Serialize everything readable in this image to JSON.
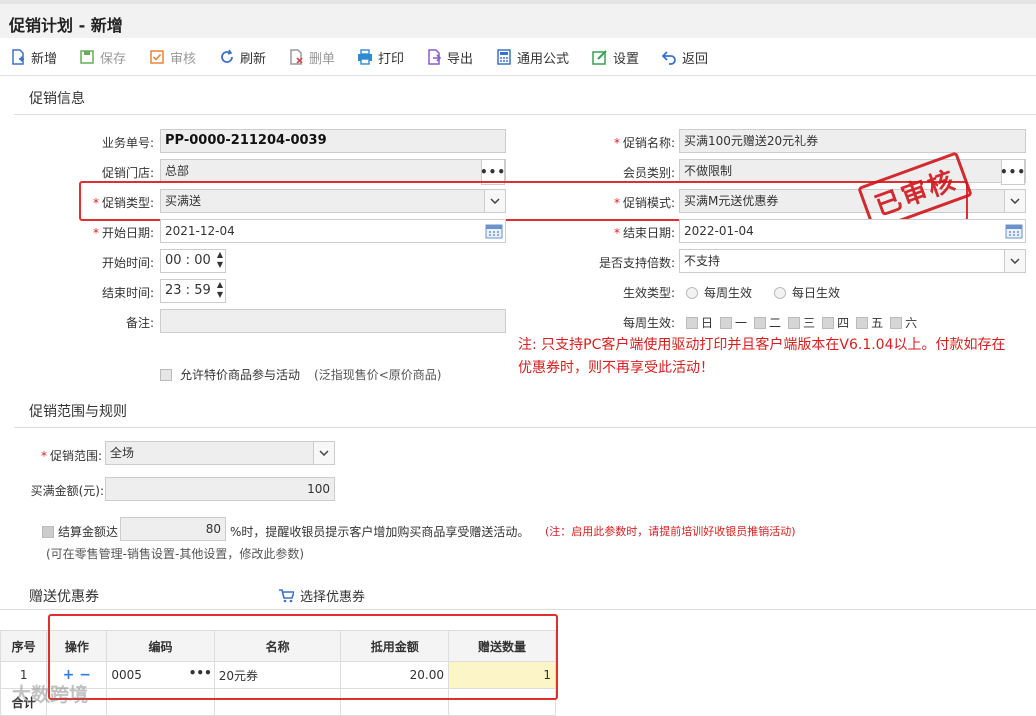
{
  "window": {
    "title": "促销计划 - 新增"
  },
  "toolbar": [
    {
      "label": "新增",
      "enabled": true,
      "icon": "new-doc-icon",
      "color": "#3a72c9"
    },
    {
      "label": "保存",
      "enabled": false,
      "icon": "save-icon",
      "color": "#6aaa5a"
    },
    {
      "label": "审核",
      "enabled": false,
      "icon": "audit-icon",
      "color": "#e6853b"
    },
    {
      "label": "刷新",
      "enabled": true,
      "icon": "refresh-icon",
      "color": "#3a72c9"
    },
    {
      "label": "删单",
      "enabled": false,
      "icon": "delete-doc-icon",
      "color": "#d94b4b"
    },
    {
      "label": "打印",
      "enabled": true,
      "icon": "print-icon",
      "color": "#2f8ad1"
    },
    {
      "label": "导出",
      "enabled": true,
      "icon": "export-icon",
      "color": "#8b5cc9"
    },
    {
      "label": "通用公式",
      "enabled": true,
      "icon": "formula-icon",
      "color": "#3a72c9"
    },
    {
      "label": "设置",
      "enabled": true,
      "icon": "settings-icon",
      "color": "#3aa054"
    },
    {
      "label": "返回",
      "enabled": true,
      "icon": "back-icon",
      "color": "#3a72c9"
    }
  ],
  "promo_info": {
    "section_title": "促销信息",
    "doc_no_label": "业务单号:",
    "doc_no": "PP-0000-211204-0039",
    "name_label": "促销名称:",
    "name": "买满100元赠送20元礼券",
    "store_label": "促销门店:",
    "store": "总部",
    "member_label": "会员类别:",
    "member": "不做限制",
    "type_label": "促销类型:",
    "type": "买满送",
    "mode_label": "促销模式:",
    "mode": "买满M元送优惠券",
    "start_date_label": "开始日期:",
    "start_date": "2021-12-04",
    "end_date_label": "结束日期:",
    "end_date": "2022-01-04",
    "start_time_label": "开始时间:",
    "start_h": "00",
    "start_m": "00",
    "end_time_label": "结束时间:",
    "end_h": "23",
    "end_m": "59",
    "multiple_label": "是否支持倍数:",
    "multiple": "不支持",
    "effect_type_label": "生效类型:",
    "effect_weekly": "每周生效",
    "effect_daily": "每日生效",
    "weekly_label": "每周生效:",
    "weekdays": [
      "日",
      "一",
      "二",
      "三",
      "四",
      "五",
      "六"
    ],
    "remark_label": "备注:",
    "special_price_label": "允许特价商品参与活动",
    "special_price_hint": "(泛指现售价<原价商品)",
    "note_line1": "注: 只支持PC客户端使用驱动打印并且客户端版本在V6.1.04以上。付款如存在",
    "note_line2": "优惠券时，则不再享受此活动！",
    "stamp": "已审核"
  },
  "scope": {
    "section_title": "促销范围与规则",
    "range_label": "促销范围:",
    "range": "全场",
    "amount_label": "买满金额(元):",
    "amount": "100",
    "settle_label": "结算金额达",
    "settle_value": "80",
    "settle_text": "%时，提醒收银员提示客户增加购买商品享受赠送活动。",
    "settle_note": "(注：启用此参数时，请提前培训好收银员推销活动)",
    "settle_hint": "(可在零售管理-销售设置-其他设置，修改此参数)"
  },
  "coupons": {
    "section_title": "赠送优惠券",
    "select_label": "选择优惠券",
    "headers": [
      "序号",
      "操作",
      "编码",
      "名称",
      "抵用金额",
      "赠送数量"
    ],
    "rows": [
      {
        "no": "1",
        "code": "0005",
        "name": "20元券",
        "amount": "20.00",
        "qty": "1"
      }
    ],
    "total_label": "合计",
    "watermark": "大数跨境"
  }
}
